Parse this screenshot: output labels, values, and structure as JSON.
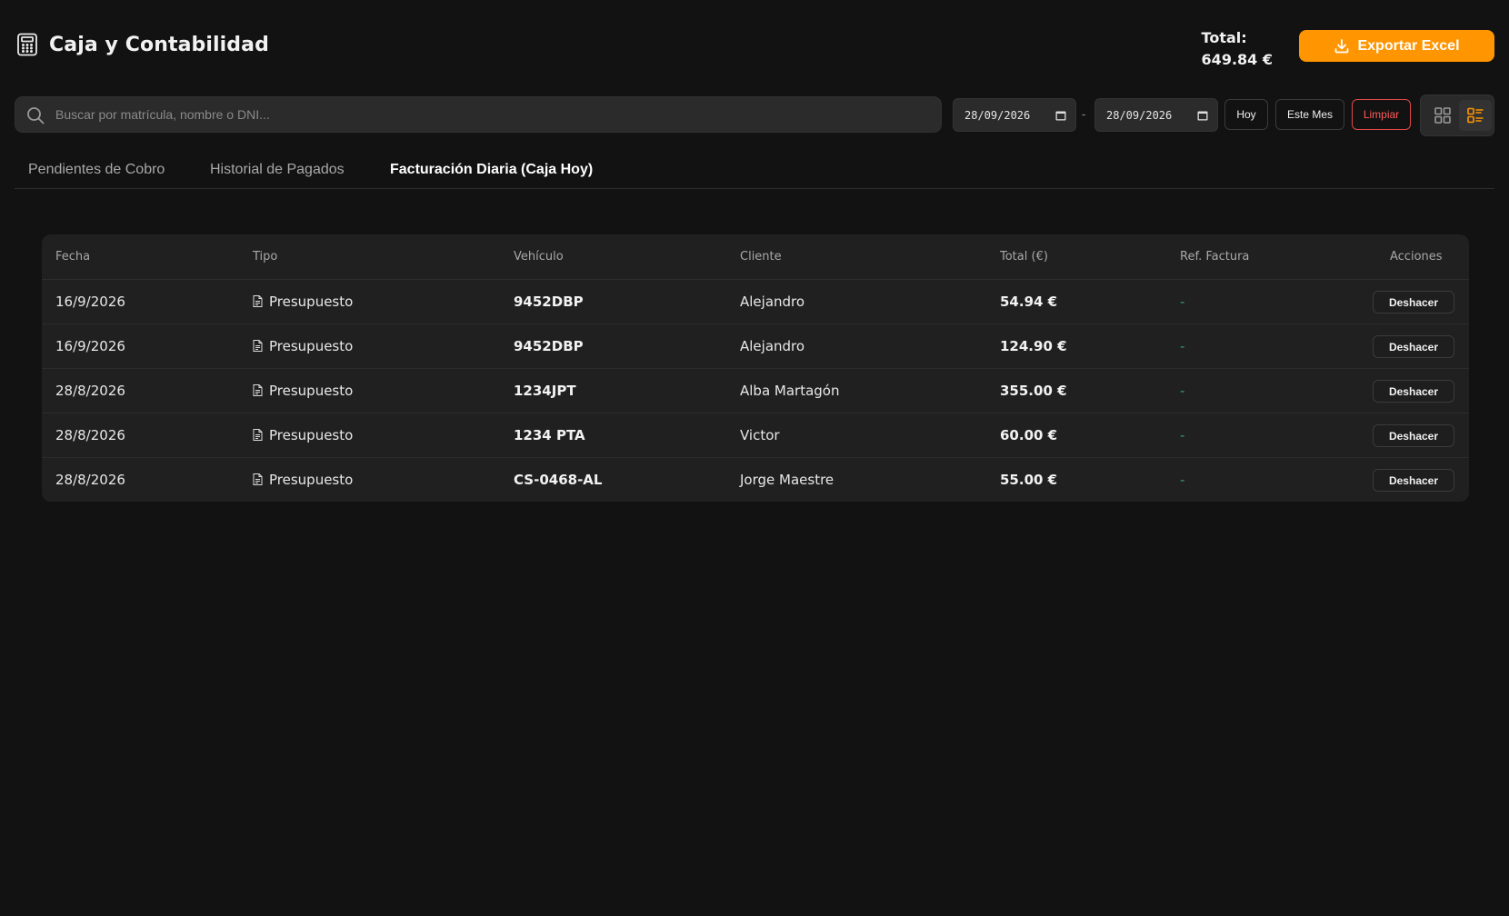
{
  "header": {
    "title": "Caja y Contabilidad",
    "total_label": "Total:",
    "total_value": "649.84 €",
    "export_label": "Exportar Excel",
    "accent": "#ff9500"
  },
  "search": {
    "placeholder": "Buscar por matrícula, nombre o DNI...",
    "value": ""
  },
  "filters": {
    "date_from": "28/09/2026",
    "date_separator": "-",
    "date_to": "28/09/2026",
    "today_label": "Hoy",
    "month_label": "Este Mes",
    "clear_label": "Limpiar",
    "view_mode": "list"
  },
  "tabs": [
    {
      "label": "Pendientes de Cobro",
      "active": false
    },
    {
      "label": "Historial de Pagados",
      "active": false
    },
    {
      "label": "Facturación Diaria (Caja Hoy)",
      "active": true
    }
  ],
  "table": {
    "columns": [
      "Fecha",
      "Tipo",
      "Vehículo",
      "Cliente",
      "Total (€)",
      "Ref. Factura",
      "Acciones"
    ],
    "rows": [
      {
        "fecha": "16/9/2026",
        "tipo": "Presupuesto",
        "vehiculo": "9452DBP",
        "cliente": "Alejandro",
        "total": "54.94 €",
        "ref": "-",
        "accion": "Deshacer"
      },
      {
        "fecha": "16/9/2026",
        "tipo": "Presupuesto",
        "vehiculo": "9452DBP",
        "cliente": "Alejandro",
        "total": "124.90 €",
        "ref": "-",
        "accion": "Deshacer"
      },
      {
        "fecha": "28/8/2026",
        "tipo": "Presupuesto",
        "vehiculo": "1234JPT",
        "cliente": "Alba Martagón",
        "total": "355.00 €",
        "ref": "-",
        "accion": "Deshacer"
      },
      {
        "fecha": "28/8/2026",
        "tipo": "Presupuesto",
        "vehiculo": "1234 PTA",
        "cliente": "Victor",
        "total": "60.00 €",
        "ref": "-",
        "accion": "Deshacer"
      },
      {
        "fecha": "28/8/2026",
        "tipo": "Presupuesto",
        "vehiculo": "CS-0468-AL",
        "cliente": "Jorge Maestre",
        "total": "55.00 €",
        "ref": "-",
        "accion": "Deshacer"
      }
    ]
  },
  "icons": {
    "title": "calculator-icon",
    "export": "download-icon",
    "search": "search-icon",
    "date": "calendar-icon",
    "grid_view": "grid-icon",
    "list_view": "list-icon",
    "tipo": "document-icon"
  }
}
